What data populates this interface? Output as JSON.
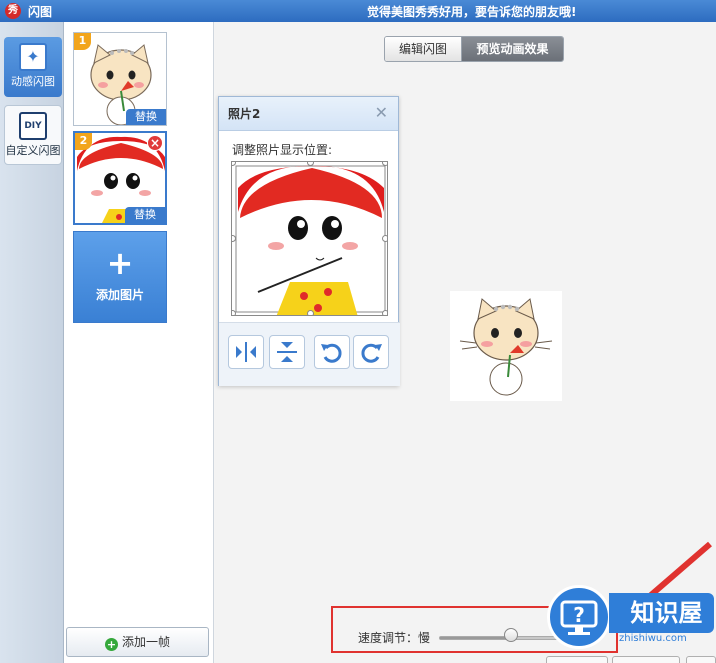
{
  "window": {
    "icon_glyph": "秀",
    "title": "闪图",
    "slogan": "觉得美图秀秀好用，要告诉您的朋友哦!"
  },
  "leftnav": {
    "items": [
      {
        "label": "动感闪图",
        "icon": "sparkle-icon",
        "active": true
      },
      {
        "label": "自定义闪图",
        "icon": "diy-icon",
        "icon_text": "DIY",
        "active": false
      }
    ]
  },
  "frames": {
    "items": [
      {
        "number": "1",
        "replace_label": "替换"
      },
      {
        "number": "2",
        "replace_label": "替换",
        "selected": true
      }
    ],
    "add_image_label": "添加图片",
    "add_frame_label": "添加一帧"
  },
  "tabs": {
    "edit": "编辑闪图",
    "preview": "预览动画效果",
    "active": "preview"
  },
  "dialog": {
    "title": "照片2",
    "hint": "调整照片显示位置:",
    "tools": [
      "flip-horizontal-icon",
      "flip-vertical-icon",
      "rotate-left-icon",
      "rotate-right-icon"
    ]
  },
  "speed": {
    "label": "速度调节：慢",
    "value": 0.55
  },
  "watermark": {
    "title": "知识屋",
    "subtitle": "zhishiwu.com"
  },
  "colors": {
    "accent": "#3a7acc",
    "highlight": "#e0322f",
    "badge": "#f2a51c"
  }
}
